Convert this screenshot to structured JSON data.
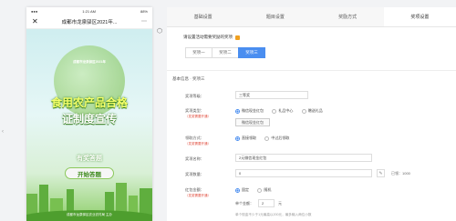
{
  "phone": {
    "status_time": "1:21 AM",
    "status_battery": "88%",
    "title": "成都市龙泉驿区2021年...",
    "close_icon": "close-icon",
    "more_icon": "more-icon",
    "poster_small": "成都市龙泉驿区2021年",
    "poster_line1": "食用农产品合格",
    "poster_line2": "证制度宣传",
    "poster_sub": "有奖答题",
    "start_button": "开始答题",
    "bottom_text": "成都市龙泉驿区农业农村局 主办"
  },
  "tabs": [
    {
      "label": "基础设置"
    },
    {
      "label": "题目设置"
    },
    {
      "label": "奖励方式"
    },
    {
      "label": "奖项设置"
    }
  ],
  "notice": "请设置活动需要奖励的奖项",
  "subtabs": [
    {
      "label": "奖项一"
    },
    {
      "label": "奖项二"
    },
    {
      "label": "奖项三"
    }
  ],
  "section_title": "基本信息 · 奖项三",
  "form": {
    "prize_level_label": "奖项等级：",
    "prize_level_value": "三等奖",
    "prize_type_label": "奖项类型：",
    "prize_type_hint": "（发奖需要开通）",
    "prize_type_options": [
      "微信现金红包",
      "礼品中心",
      "赠送礼品"
    ],
    "prize_type_selected": "微信现金红包",
    "claim_method_label": "领取方式：",
    "claim_method_hint": "（发奖需要开通）",
    "claim_options": [
      "直接领取",
      "中过后领取"
    ],
    "prize_name_label": "奖项名称：",
    "prize_name_value": "2元微信现金红包",
    "prize_count_label": "奖项数量：",
    "prize_count_value": "0",
    "prize_count_suffix": "已领：1000",
    "redpack_amount_label": "红包金额：",
    "redpack_amount_hint": "（发奖需要开通）",
    "amount_options": [
      "固定",
      "随机"
    ],
    "single_amount_label": "单个金额：",
    "single_amount_value": "2",
    "single_amount_unit": "元",
    "help_text": "单个现金不少于1元最高以200元，最多输入两位小数"
  }
}
